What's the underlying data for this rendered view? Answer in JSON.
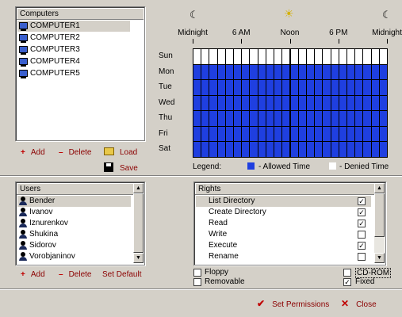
{
  "computers": {
    "header": "Computers",
    "items": [
      "COMPUTER1",
      "COMPUTER2",
      "COMPUTER3",
      "COMPUTER4",
      "COMPUTER5"
    ],
    "add_label": "Add",
    "delete_label": "Delete",
    "load_label": "Load",
    "save_label": "Save"
  },
  "schedule": {
    "times": [
      "Midnight",
      "6 AM",
      "Noon",
      "6 PM",
      "Midnight"
    ],
    "days": [
      "Sun",
      "Mon",
      "Tue",
      "Wed",
      "Thu",
      "Fri",
      "Sat"
    ],
    "hours_per_day": 24,
    "allowed_days": [
      "Mon",
      "Tue",
      "Wed",
      "Thu",
      "Fri",
      "Sat"
    ],
    "legend_label": "Legend:",
    "allowed_label": "- Allowed Time",
    "denied_label": "- Denied Time",
    "allowed_color": "#1f3fe0",
    "denied_color": "#ffffff"
  },
  "users": {
    "header": "Users",
    "items": [
      "Bender",
      "Ivanov",
      "Iznurenkov",
      "Shukina",
      "Sidorov",
      "Vorobjaninov"
    ],
    "add_label": "Add",
    "delete_label": "Delete",
    "default_label": "Set Default"
  },
  "rights": {
    "header": "Rights",
    "items": [
      {
        "label": "List Directory",
        "checked": true
      },
      {
        "label": "Create Directory",
        "checked": true
      },
      {
        "label": "Read",
        "checked": true
      },
      {
        "label": "Write",
        "checked": false
      },
      {
        "label": "Execute",
        "checked": true
      },
      {
        "label": "Rename",
        "checked": false
      }
    ]
  },
  "drives": {
    "floppy": {
      "label": "Floppy",
      "checked": false
    },
    "removable": {
      "label": "Removable",
      "checked": false
    },
    "cdrom": {
      "label": "CD-ROM",
      "checked": false
    },
    "fixed": {
      "label": "Fixed",
      "checked": true
    }
  },
  "footer": {
    "set_permissions_label": "Set Permissions",
    "close_label": "Close"
  }
}
